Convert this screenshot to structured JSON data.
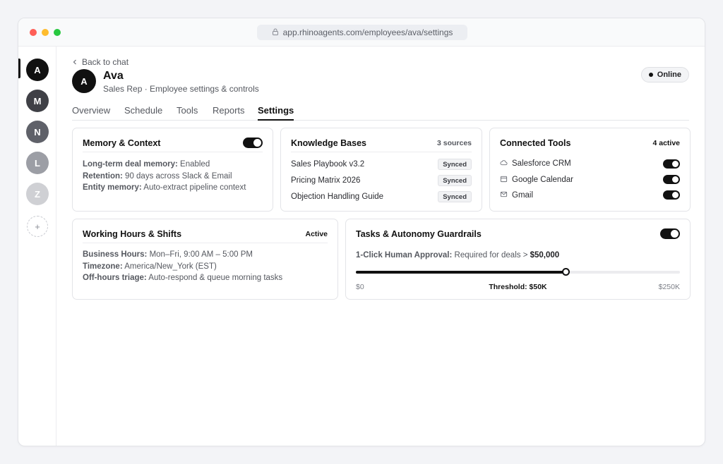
{
  "browser": {
    "url": "app.rhinoagents.com/employees/ava/settings"
  },
  "sidebar": {
    "avatars": [
      {
        "initial": "A",
        "color": "#111111"
      },
      {
        "initial": "M",
        "color": "#3f4046"
      },
      {
        "initial": "N",
        "color": "#5f6169"
      },
      {
        "initial": "L",
        "color": "#9c9ea5"
      },
      {
        "initial": "Z",
        "color": "#cfd0d4"
      }
    ],
    "add_label": "+"
  },
  "header": {
    "back_label": "Back to chat",
    "avatar_initial": "A",
    "name": "Ava",
    "subtitle": "Sales Rep · Employee settings & controls",
    "status": "Online"
  },
  "tabs": [
    {
      "label": "Overview"
    },
    {
      "label": "Schedule"
    },
    {
      "label": "Tools"
    },
    {
      "label": "Reports"
    },
    {
      "label": "Settings"
    }
  ],
  "memory": {
    "title": "Memory & Context",
    "enabled": true,
    "lines": [
      {
        "label": "Long-term deal memory:",
        "value": " Enabled"
      },
      {
        "label": "Retention:",
        "value": " 90 days across Slack & Email"
      },
      {
        "label": "Entity memory:",
        "value": " Auto-extract pipeline context"
      }
    ]
  },
  "knowledge": {
    "title": "Knowledge Bases",
    "meta": "3 sources",
    "items": [
      {
        "name": "Sales Playbook v3.2",
        "status": "Synced"
      },
      {
        "name": "Pricing Matrix 2026",
        "status": "Synced"
      },
      {
        "name": "Objection Handling Guide",
        "status": "Synced"
      }
    ]
  },
  "tools": {
    "title": "Connected Tools",
    "meta": "4 active",
    "items": [
      {
        "name": "Salesforce CRM",
        "icon": "cloud-icon",
        "enabled": true
      },
      {
        "name": "Google Calendar",
        "icon": "calendar-icon",
        "enabled": true
      },
      {
        "name": "Gmail",
        "icon": "mail-icon",
        "enabled": true
      }
    ]
  },
  "hours": {
    "title": "Working Hours & Shifts",
    "meta": "Active",
    "lines": [
      {
        "label": "Business Hours:",
        "value": " Mon–Fri, 9:00 AM – 5:00 PM"
      },
      {
        "label": "Timezone:",
        "value": " America/New_York (EST)"
      },
      {
        "label": "Off-hours triage:",
        "value": " Auto-respond & queue morning tasks"
      }
    ]
  },
  "guardrails": {
    "title": "Tasks & Autonomy Guardrails",
    "enabled": true,
    "approval_label": "1-Click Human Approval:",
    "approval_text": " Required for deals > ",
    "approval_amount": "$50,000",
    "slider_fraction": 0.648,
    "scale_min": "$0",
    "scale_mid": "Threshold: $50K",
    "scale_max": "$250K"
  },
  "colors": {
    "accent": "#111111",
    "muted": "#55585f",
    "border": "#e3e4e8"
  }
}
